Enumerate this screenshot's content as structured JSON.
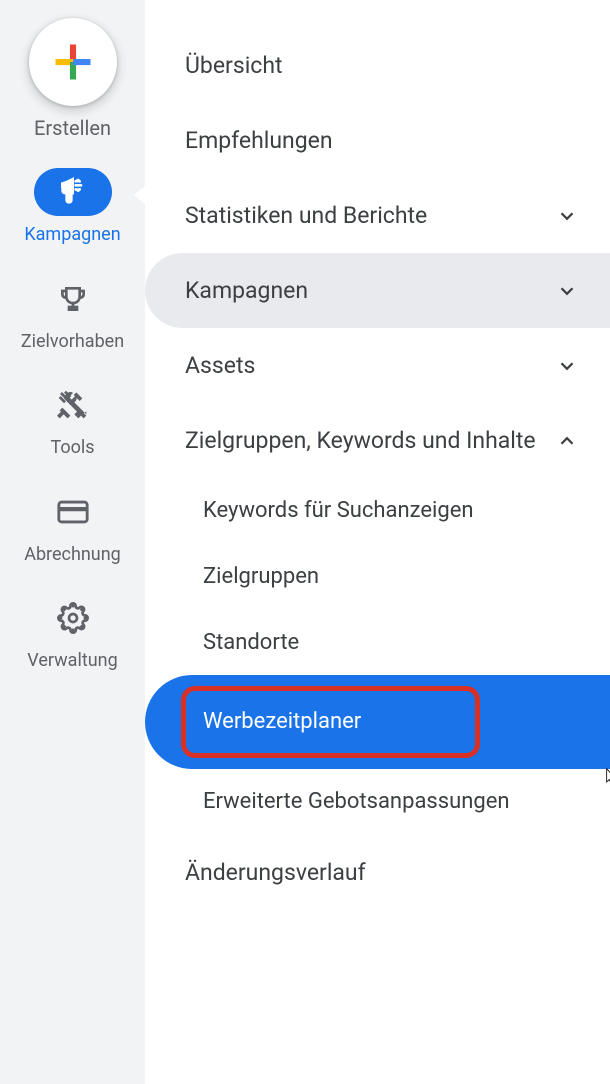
{
  "sidebar": {
    "create_label": "Erstellen",
    "items": [
      {
        "label": "Kampagnen",
        "active": true
      },
      {
        "label": "Zielvorhaben",
        "active": false
      },
      {
        "label": "Tools",
        "active": false
      },
      {
        "label": "Abrechnung",
        "active": false
      },
      {
        "label": "Verwaltung",
        "active": false
      }
    ]
  },
  "menu": {
    "items": [
      {
        "label": "Übersicht",
        "expandable": false
      },
      {
        "label": "Empfehlungen",
        "expandable": false
      },
      {
        "label": "Statistiken und Berichte",
        "expandable": true,
        "expanded": false
      },
      {
        "label": "Kampagnen",
        "expandable": true,
        "expanded": false,
        "hovered": true
      },
      {
        "label": "Assets",
        "expandable": true,
        "expanded": false
      },
      {
        "label": "Zielgruppen, Keywords und Inhalte",
        "expandable": true,
        "expanded": true,
        "children": [
          {
            "label": "Keywords für Suchanzeigen"
          },
          {
            "label": "Zielgruppen"
          },
          {
            "label": "Standorte"
          },
          {
            "label": "Werbezeitplaner",
            "selected": true,
            "highlighted": true
          },
          {
            "label": "Erweiterte Gebotsanpassungen"
          }
        ]
      },
      {
        "label": "Änderungsverlauf",
        "expandable": false
      }
    ]
  }
}
